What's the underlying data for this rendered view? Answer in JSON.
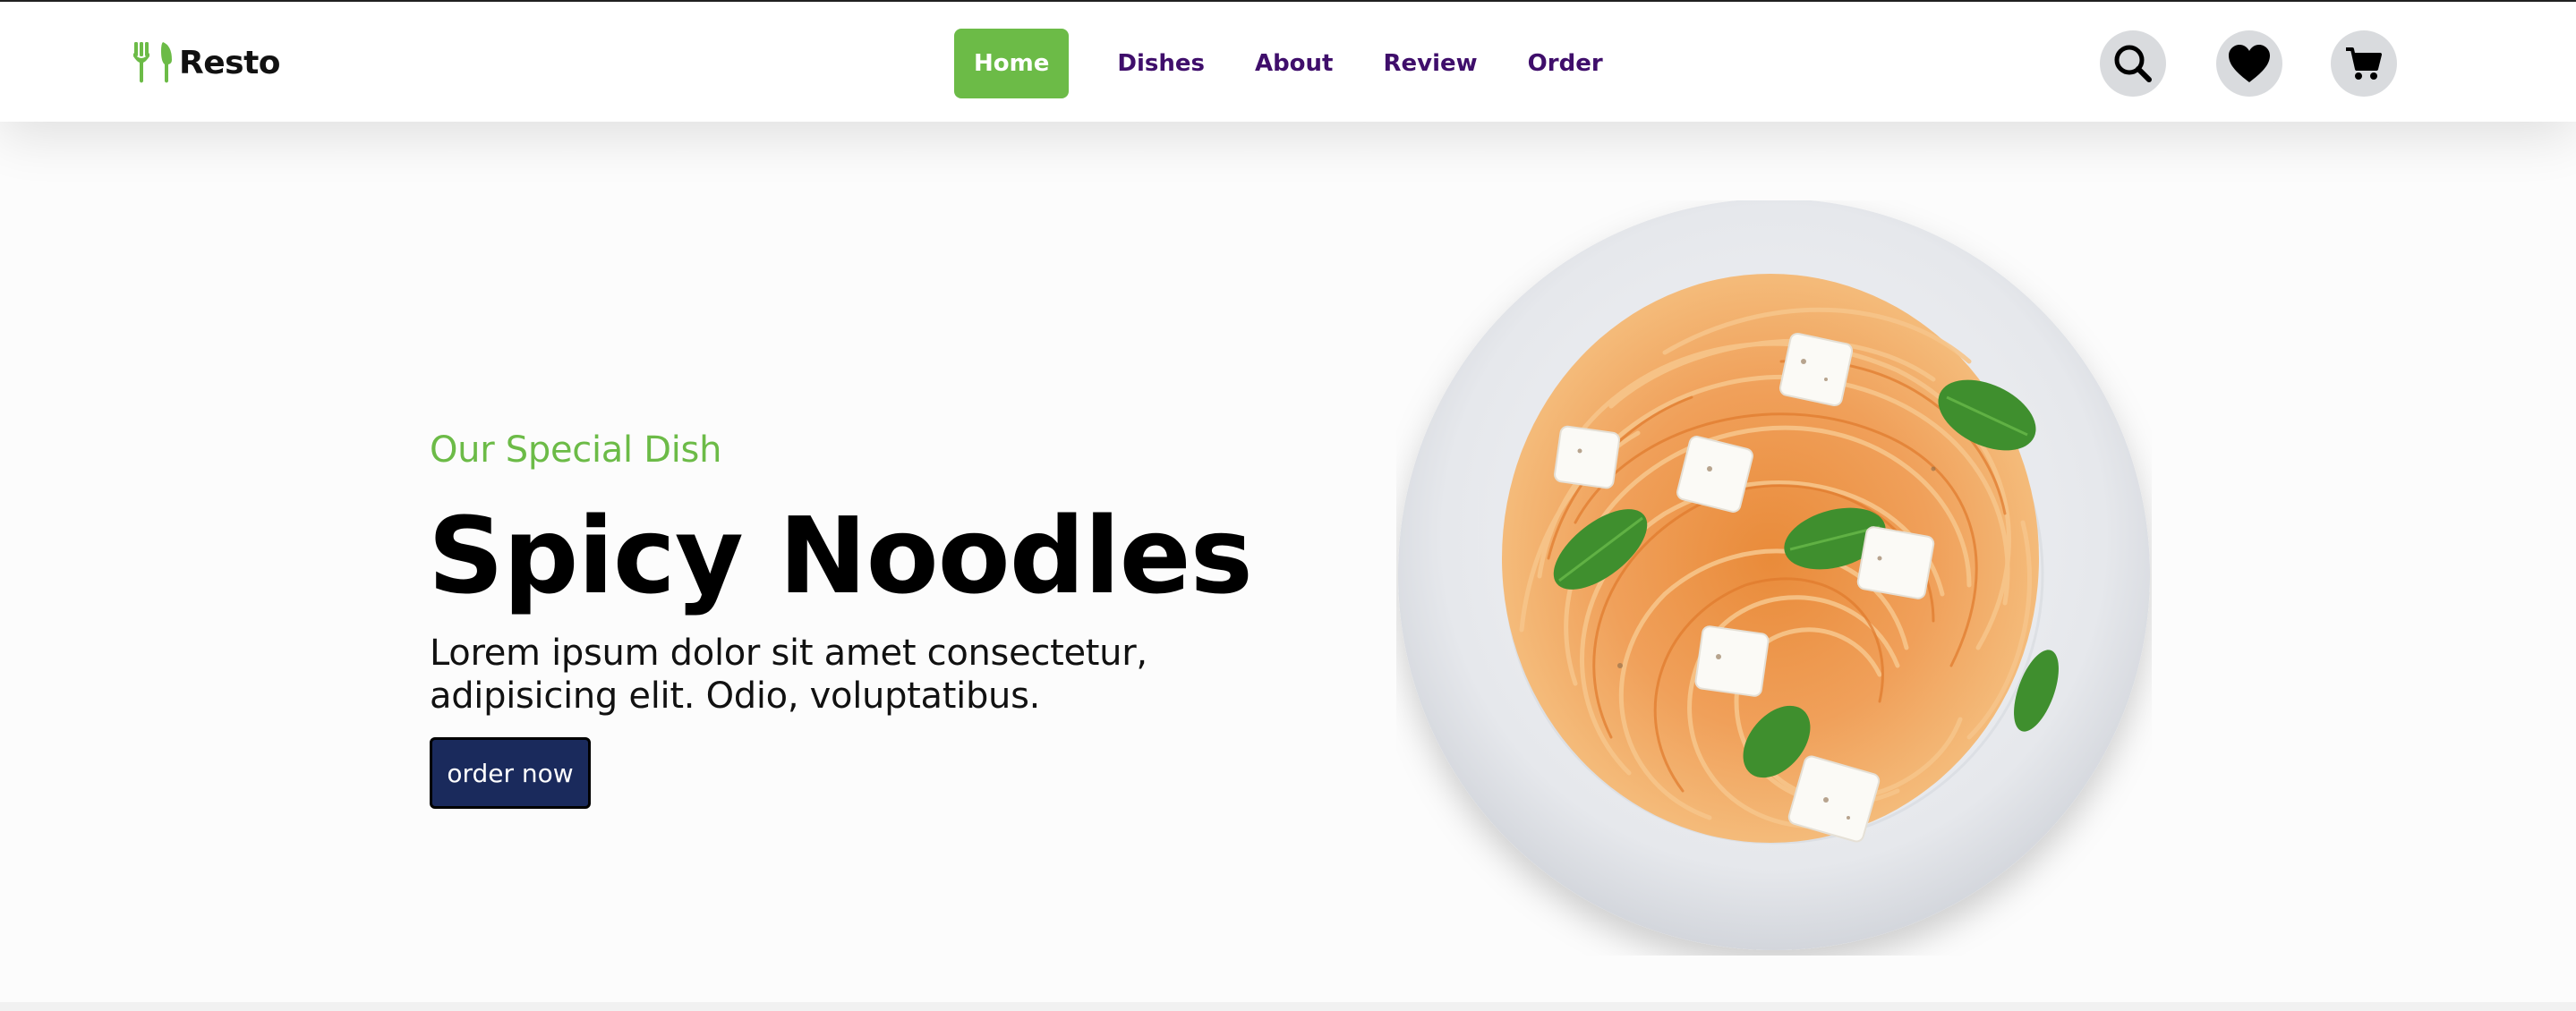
{
  "brand": {
    "name": "Resto",
    "accent_color": "#6cbb47",
    "nav_text_color": "#3f0e6b",
    "button_color": "#1a2a5c"
  },
  "nav": {
    "items": [
      {
        "label": "Home",
        "active": true
      },
      {
        "label": "Dishes",
        "active": false
      },
      {
        "label": "About",
        "active": false
      },
      {
        "label": "Review",
        "active": false
      },
      {
        "label": "Order",
        "active": false
      }
    ]
  },
  "header_icons": [
    {
      "name": "search-icon"
    },
    {
      "name": "heart-icon"
    },
    {
      "name": "cart-icon"
    }
  ],
  "hero": {
    "subtitle": "Our Special Dish",
    "title": "Spicy Noodles",
    "description": "Lorem ipsum dolor sit amet consectetur, adipisicing elit. Odio, voluptatibus.",
    "button_label": "order now",
    "image": "spaghetti-plate"
  }
}
